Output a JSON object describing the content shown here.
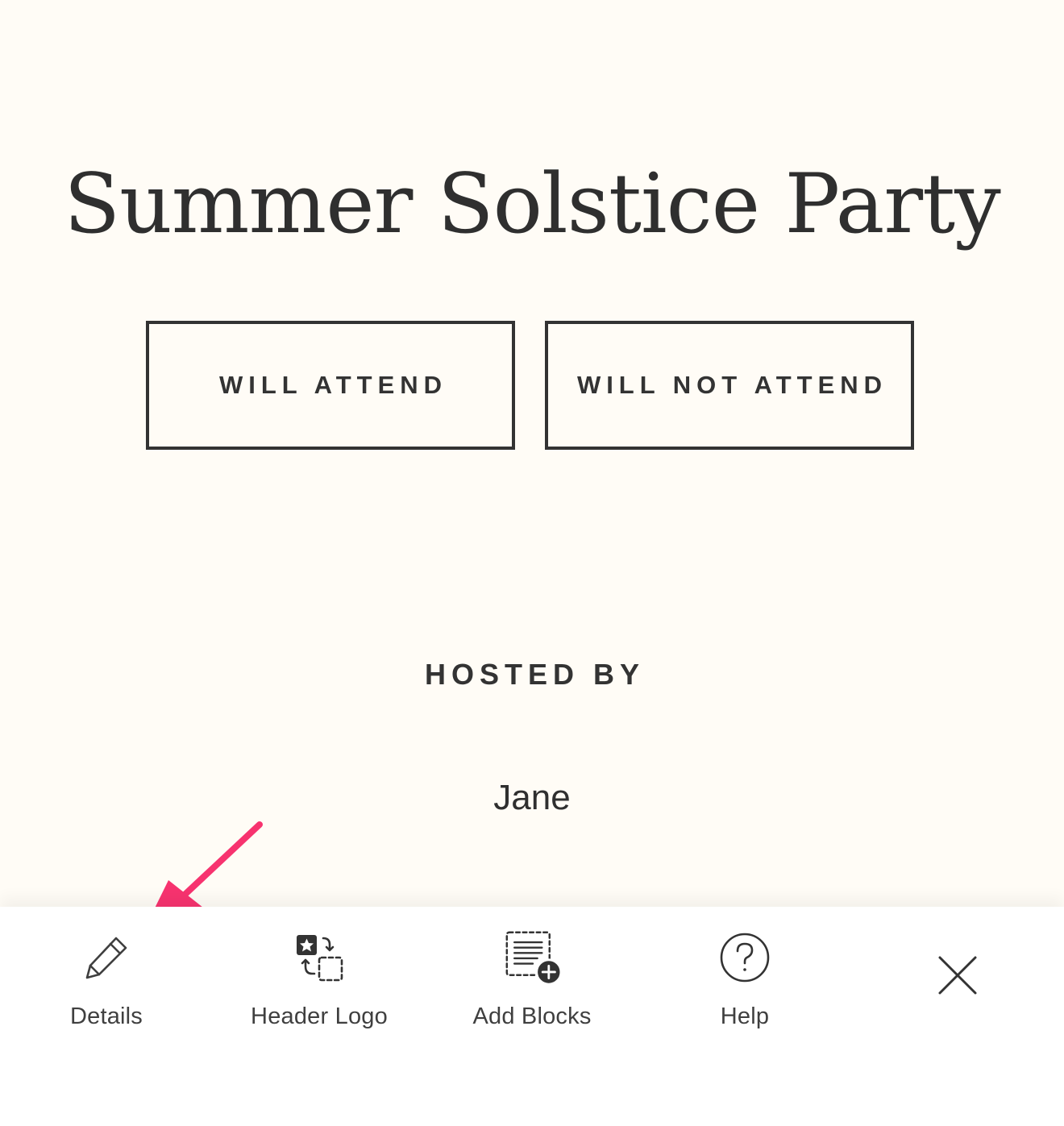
{
  "event": {
    "title": "Summer Solstice Party",
    "rsvp": {
      "attend_label": "WILL ATTEND",
      "not_attend_label": "WILL NOT ATTEND"
    },
    "hosted_heading": "HOSTED BY",
    "host_name": "Jane"
  },
  "toolbar": {
    "items": [
      {
        "label": "Details",
        "icon": "pencil-icon"
      },
      {
        "label": "Header Logo",
        "icon": "swap-logo-icon"
      },
      {
        "label": "Add Blocks",
        "icon": "add-blocks-icon"
      },
      {
        "label": "Help",
        "icon": "help-circle-icon"
      }
    ],
    "close_icon": "close-icon"
  },
  "colors": {
    "page_background": "#fffcf6",
    "text": "#333333",
    "toolbar_background": "#ffffff",
    "annotation_arrow": "#f7336f"
  }
}
